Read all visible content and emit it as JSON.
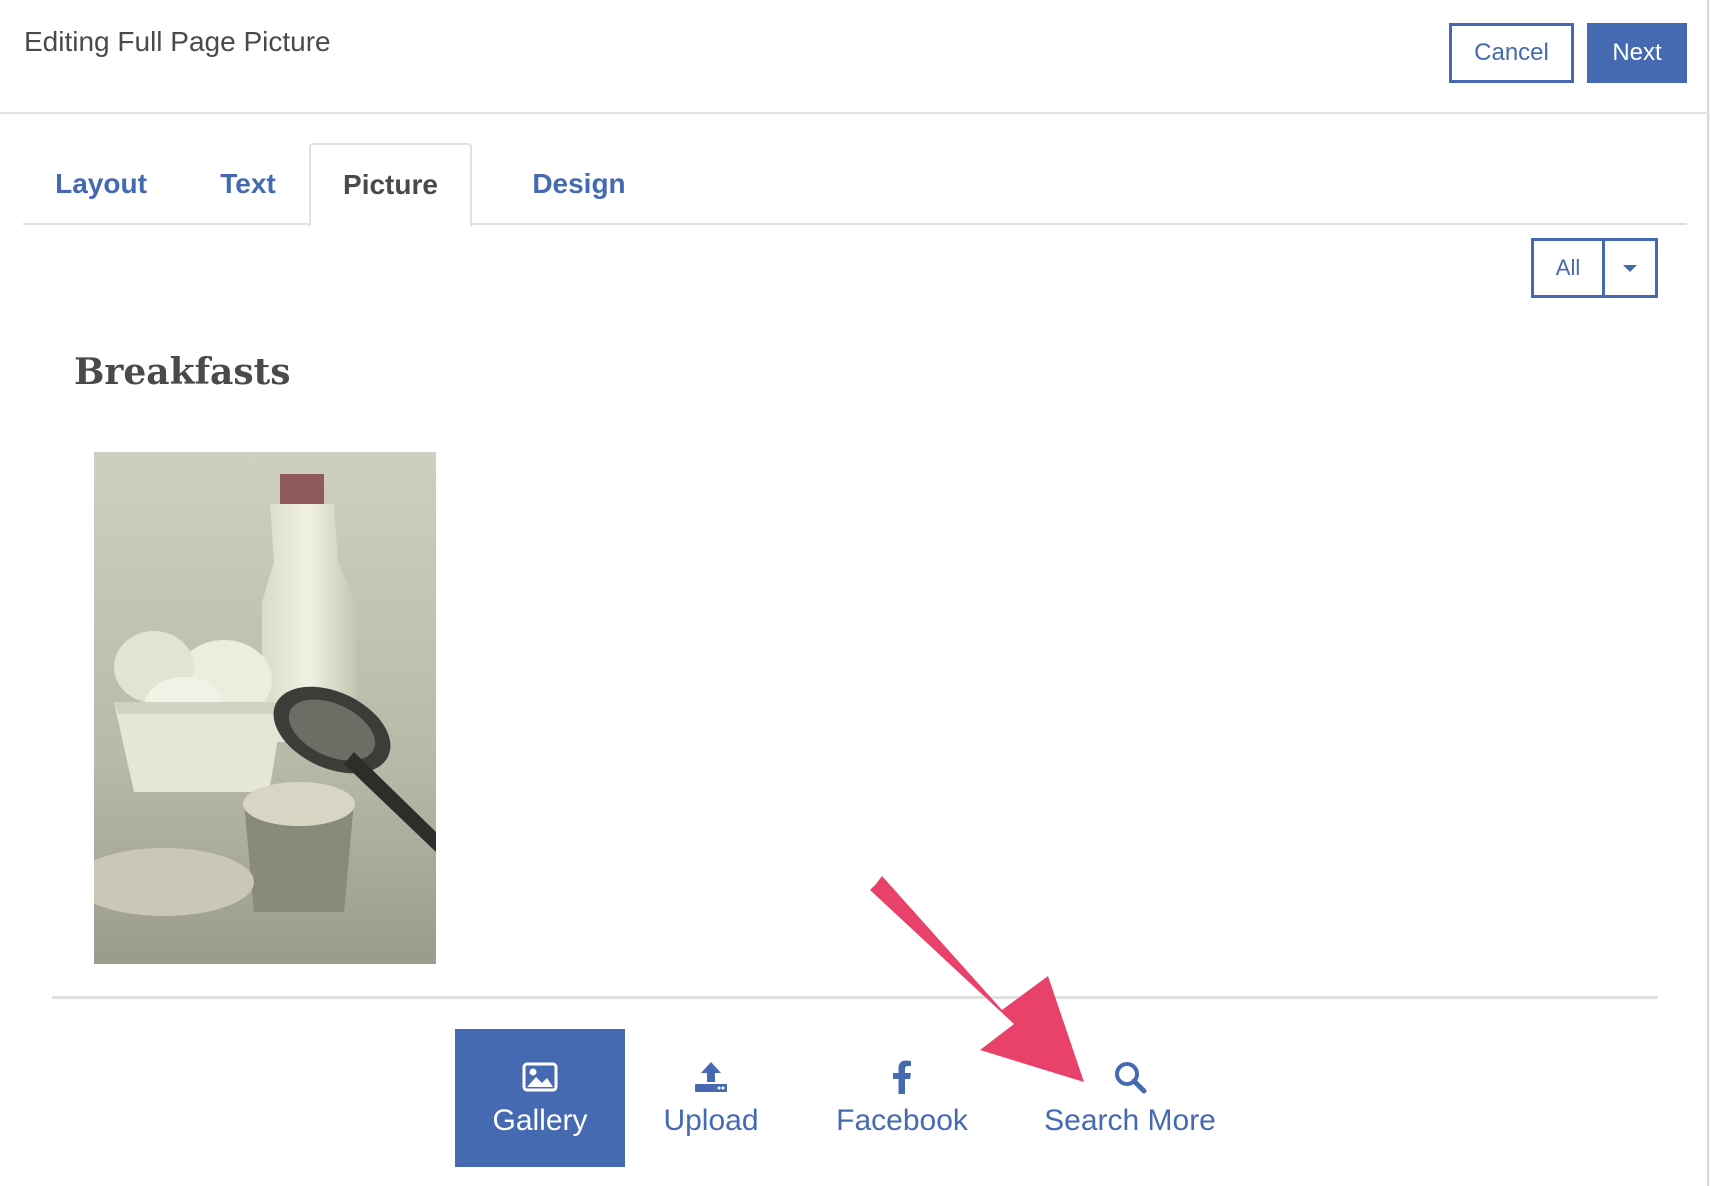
{
  "header": {
    "title": "Editing Full Page Picture",
    "cancel_label": "Cancel",
    "next_label": "Next"
  },
  "tabs": [
    {
      "label": "Layout",
      "active": false
    },
    {
      "label": "Text",
      "active": false
    },
    {
      "label": "Picture",
      "active": true
    },
    {
      "label": "Design",
      "active": false
    }
  ],
  "filter": {
    "selected": "All"
  },
  "gallery": {
    "section_title": "Breakfasts"
  },
  "sources": [
    {
      "label": "Gallery",
      "icon": "image-icon",
      "active": true
    },
    {
      "label": "Upload",
      "icon": "upload-icon",
      "active": false
    },
    {
      "label": "Facebook",
      "icon": "facebook-icon",
      "active": false
    },
    {
      "label": "Search More",
      "icon": "search-icon",
      "active": false
    }
  ],
  "colors": {
    "accent": "#456ab1",
    "annotation_arrow": "#e8426b"
  }
}
